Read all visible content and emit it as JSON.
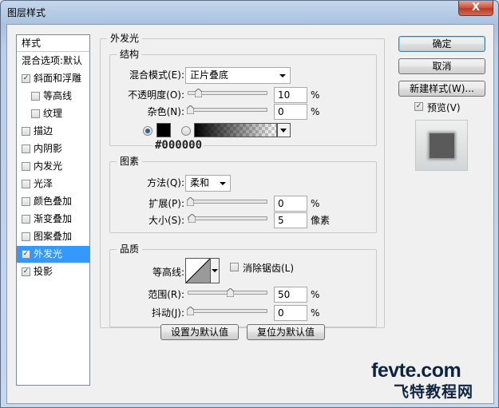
{
  "window": {
    "title": "图层样式",
    "close_label": "X"
  },
  "sidebar": {
    "header": "样式",
    "items": [
      {
        "label": "混合选项:默认",
        "checkbox": false,
        "checked": false
      },
      {
        "label": "斜面和浮雕",
        "checkbox": true,
        "checked": true
      },
      {
        "label": "等高线",
        "checkbox": true,
        "checked": false
      },
      {
        "label": "纹理",
        "checkbox": true,
        "checked": false
      },
      {
        "label": "描边",
        "checkbox": true,
        "checked": false
      },
      {
        "label": "内阴影",
        "checkbox": true,
        "checked": false
      },
      {
        "label": "内发光",
        "checkbox": true,
        "checked": false
      },
      {
        "label": "光泽",
        "checkbox": true,
        "checked": false
      },
      {
        "label": "颜色叠加",
        "checkbox": true,
        "checked": false
      },
      {
        "label": "渐变叠加",
        "checkbox": true,
        "checked": false
      },
      {
        "label": "图案叠加",
        "checkbox": true,
        "checked": false
      },
      {
        "label": "外发光",
        "checkbox": true,
        "checked": true,
        "selected": true
      },
      {
        "label": "投影",
        "checkbox": true,
        "checked": true
      }
    ]
  },
  "panel": {
    "title": "外发光",
    "structure": {
      "title": "结构",
      "blend_label": "混合模式(E):",
      "blend_value": "正片叠底",
      "opacity_label": "不透明度(O):",
      "opacity_value": "10",
      "opacity_level": 0.1,
      "noise_label": "杂色(N):",
      "noise_value": "0",
      "noise_level": 0,
      "percent": "%",
      "color_hex": "#000000",
      "color_caption": "#000000",
      "radio_color_selected": true
    },
    "elements": {
      "title": "图素",
      "method_label": "方法(Q):",
      "method_value": "柔和",
      "spread_label": "扩展(P):",
      "spread_value": "0",
      "spread_level": 0,
      "size_label": "大小(S):",
      "size_value": "5",
      "size_level": 0.02,
      "percent": "%",
      "px_unit": "像素"
    },
    "quality": {
      "title": "品质",
      "contour_label": "等高线:",
      "antialias_label": "消除锯齿(L)",
      "range_label": "范围(R):",
      "range_value": "50",
      "range_level": 0.5,
      "jitter_label": "抖动(J):",
      "jitter_value": "0",
      "jitter_level": 0,
      "percent": "%"
    },
    "set_default": "设置为默认值",
    "reset_default": "复位为默认值"
  },
  "buttons": {
    "ok": "确定",
    "cancel": "取消",
    "new_style": "新建样式(W)...",
    "preview_label": "预览(V)",
    "preview_checked": true
  },
  "watermark": {
    "line1": "fevte.com",
    "line2": "飞特教程网"
  },
  "colors": {
    "selection": "#3399ff",
    "glow": "#000000"
  }
}
